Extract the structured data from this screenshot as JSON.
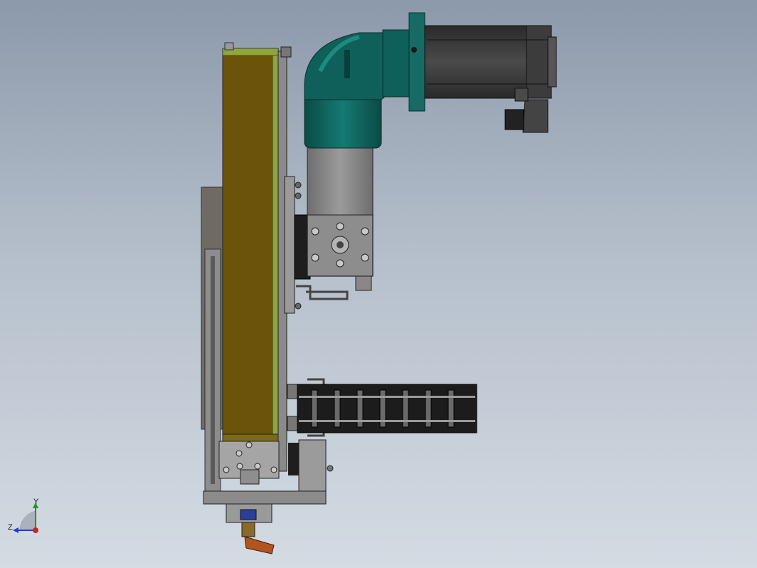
{
  "viewport": {
    "background_top": "#8c99ab",
    "background_bottom": "#d4dbe3"
  },
  "model": {
    "name": "",
    "colors": {
      "actuator_body": "#6b5409",
      "actuator_edge": "#8fa63a",
      "gearbox_teal": "#0f5f5a",
      "motor_body": "#333333",
      "adapter_gray": "#8a8a8a",
      "cable_chain": "#1c1c1c",
      "handle_orange": "#b2541e",
      "handle_blue": "#2a3f9a"
    }
  },
  "triad": {
    "y_label": "Y",
    "z_label": "Z",
    "x_icon": "x-axis-arrow-red",
    "y_icon": "y-axis-arrow-green",
    "z_icon": "z-axis-arrow-blue"
  }
}
